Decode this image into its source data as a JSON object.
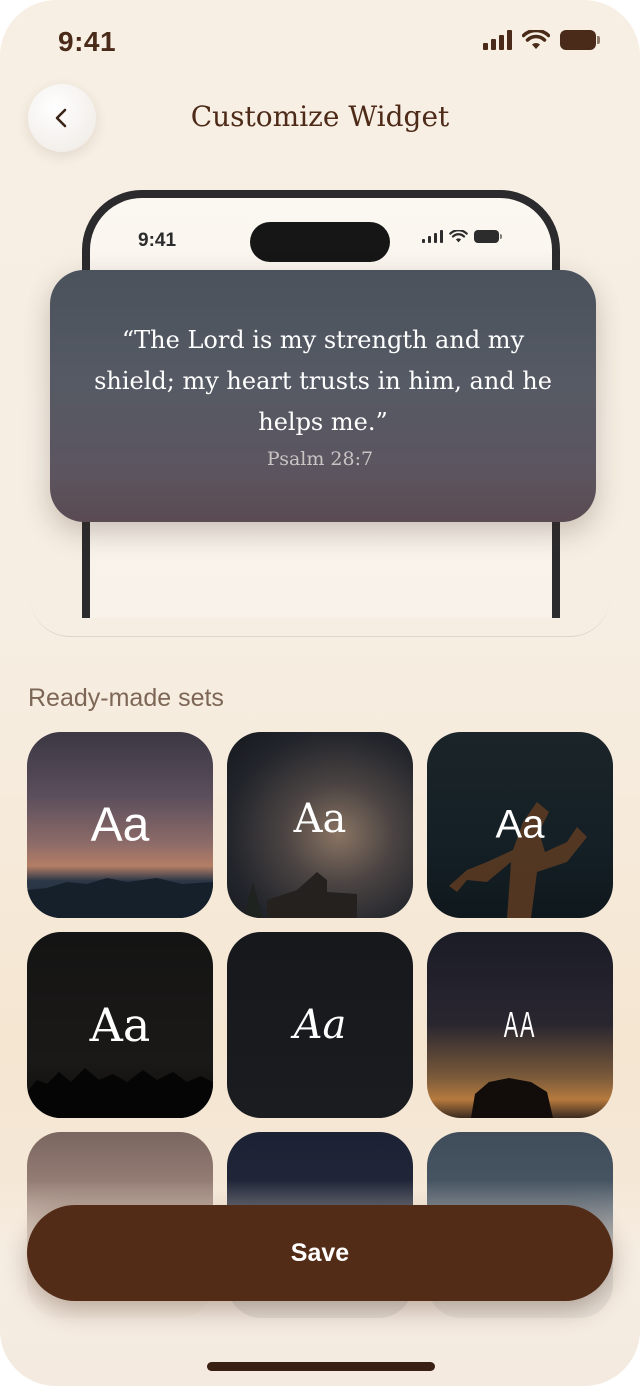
{
  "status_bar": {
    "time": "9:41"
  },
  "header": {
    "title": "Customize Widget",
    "back_icon": "chevron-left-icon"
  },
  "preview": {
    "time": "9:41",
    "quote": "“The Lord is my strength and my shield; my heart trusts in him, and he helps me.”",
    "reference": "Psalm 28:7"
  },
  "sets": {
    "label": "Ready-made sets",
    "items": [
      {
        "text": "Aa"
      },
      {
        "text": "Aa"
      },
      {
        "text": "Aa"
      },
      {
        "text": "Aa"
      },
      {
        "text": "Aa"
      },
      {
        "text": "AA"
      },
      {
        "text": ""
      },
      {
        "text": ""
      },
      {
        "text": ""
      }
    ]
  },
  "footer": {
    "save_label": "Save"
  },
  "colors": {
    "primary": "#532C18",
    "background": "#F7EFE4",
    "title_text": "#4E2B18",
    "section_text": "#7D6656"
  }
}
